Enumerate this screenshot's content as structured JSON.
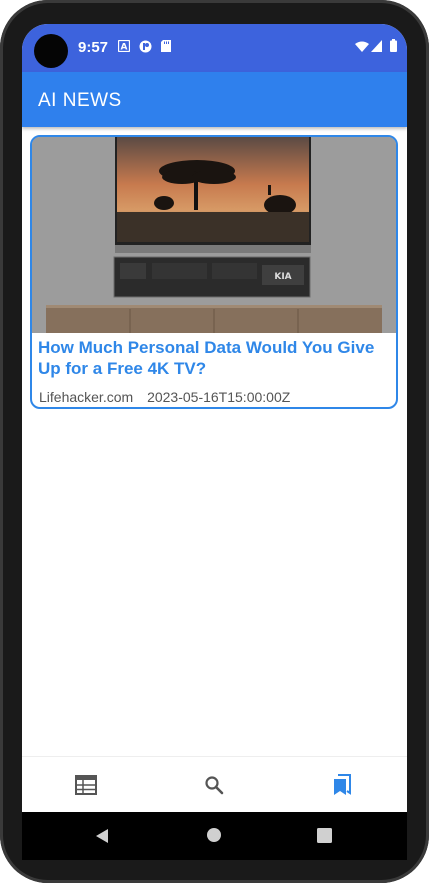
{
  "status_bar": {
    "time": "9:57",
    "icons": [
      "a-notification-icon",
      "media-notification-icon",
      "sd-card-icon",
      "wifi-icon",
      "signal-icon",
      "battery-icon"
    ]
  },
  "app_bar": {
    "title": "AI NEWS"
  },
  "articles": [
    {
      "headline": "How Much Personal Data Would You Give Up for a Free 4K TV?",
      "source": "Lifehacker.com",
      "published": "2023-05-16T15:00:00Z",
      "image_caption": "KIA"
    }
  ],
  "bottom_nav": {
    "items": [
      {
        "icon": "news-feed-icon",
        "active": false
      },
      {
        "icon": "search-icon",
        "active": false
      },
      {
        "icon": "bookmarks-icon",
        "active": true
      }
    ]
  },
  "colors": {
    "status_bar": "#3d63dd",
    "app_bar": "#2f80ed",
    "accent": "#2f87e8",
    "inactive_icon": "#555555"
  }
}
